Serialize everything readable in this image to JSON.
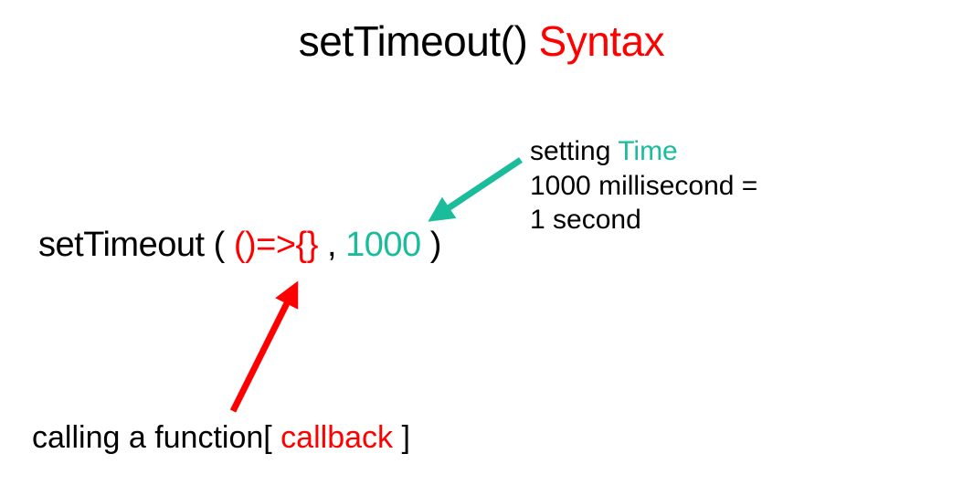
{
  "title": {
    "part1": "setTimeout() ",
    "part2": "Syntax"
  },
  "code": {
    "fn_name": "setTimeout",
    "open_paren": " ( ",
    "callback": "()=>{}",
    "separator": " , ",
    "delay": "1000",
    "close_paren": " )"
  },
  "annotation_time": {
    "line1a": "setting ",
    "line1b": "Time",
    "line2": "1000 millisecond =",
    "line3": "1 second"
  },
  "annotation_callback": {
    "part1": "calling a function[ ",
    "part2": "callback",
    "part3": " ]"
  }
}
